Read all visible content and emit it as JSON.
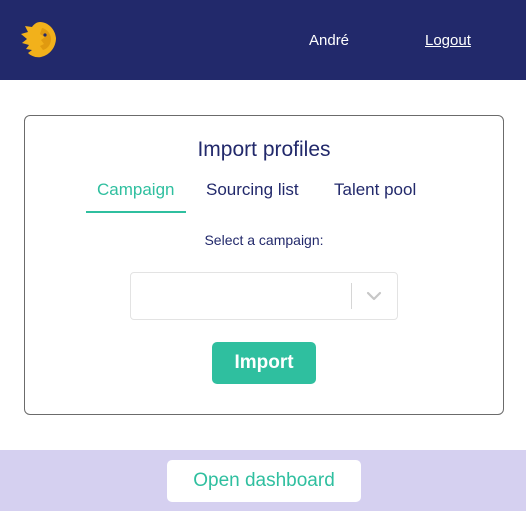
{
  "header": {
    "logo_icon": "lion-head-icon",
    "user_name": "André",
    "logout_label": "Logout"
  },
  "import_card": {
    "title": "Import profiles",
    "tabs": [
      {
        "label": "Campaign",
        "active": true
      },
      {
        "label": "Sourcing list",
        "active": false
      },
      {
        "label": "Talent pool",
        "active": false
      }
    ],
    "select_label": "Select a campaign:",
    "select_value": "",
    "select_icon": "chevron-down-icon",
    "import_label": "Import"
  },
  "footer": {
    "dashboard_label": "Open dashboard"
  },
  "colors": {
    "header_bg": "#22296b",
    "accent": "#2fbf9f",
    "footer_bg": "#d5d0f0",
    "logo": "#f2b11b"
  }
}
